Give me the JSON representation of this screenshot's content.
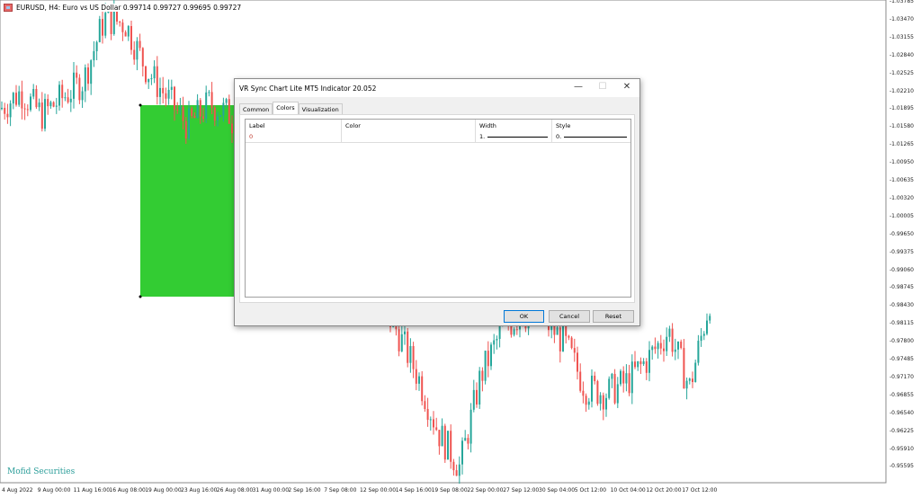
{
  "chart": {
    "title": "EURUSD, H4:  Euro vs US Dollar  0.99714 0.99727 0.99695 0.99727",
    "brand": "Mofid Securities",
    "up_color": "#26a69a",
    "down_color": "#ef5350",
    "highlight_color": "#33cc33",
    "price_labels": [
      "1.03785",
      "1.03470",
      "1.03155",
      "1.02840",
      "1.02525",
      "1.02210",
      "1.01895",
      "1.01580",
      "1.01265",
      "1.00950",
      "1.00635",
      "1.00320",
      "1.00005",
      "0.99650",
      "0.99375",
      "0.99060",
      "0.98745",
      "0.98430",
      "0.98115",
      "0.97800",
      "0.97485",
      "0.97170",
      "0.96855",
      "0.96540",
      "0.96225",
      "0.95910",
      "0.95595"
    ],
    "time_labels": [
      "4 Aug 2022",
      "9 Aug 00:00",
      "11 Aug 16:00",
      "16 Aug 08:00",
      "19 Aug 00:00",
      "23 Aug 16:00",
      "26 Aug 08:00",
      "31 Aug 00:00",
      "2 Sep 16:00",
      "7 Sep 08:00",
      "12 Sep 00:00",
      "14 Sep 16:00",
      "19 Sep 08:00",
      "22 Sep 00:00",
      "27 Sep 12:00",
      "30 Sep 04:00",
      "5 Oct 12:00",
      "10 Oct 04:00",
      "12 Oct 20:00",
      "17 Oct 12:00"
    ],
    "price_path": [
      1.019,
      1.022,
      1.018,
      1.021,
      1.024,
      1.035,
      1.034,
      1.026,
      1.021,
      1.016,
      1.02,
      1.018,
      1.008,
      0.995,
      0.991,
      0.995,
      0.992,
      0.99,
      0.986,
      0.98,
      0.972,
      0.962,
      0.956,
      0.972,
      0.98,
      0.983,
      0.982,
      0.978,
      0.97,
      0.969,
      0.971,
      0.975,
      0.98,
      0.97,
      0.986
    ]
  },
  "dialog": {
    "title": "VR Sync Chart Lite MT5 Indicator 20.052",
    "minimize": "—",
    "maximize": "☐",
    "close": "✕",
    "tabs": [
      "Common",
      "Colors",
      "Visualization"
    ],
    "columns": [
      "Label",
      "Color",
      "Width",
      "Style"
    ],
    "rows": [
      {
        "label": "0",
        "color": "",
        "width": "1.",
        "style": "0."
      }
    ],
    "ok": "OK",
    "cancel": "Cancel",
    "reset": "Reset"
  }
}
